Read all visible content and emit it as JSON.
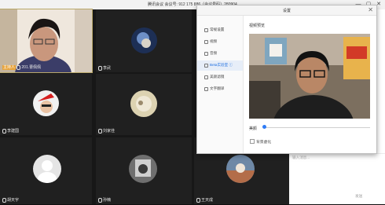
{
  "window": {
    "title": "腾讯会议 会议号: 912 175 886（会议号码）280904",
    "minimize_label": "—",
    "maximize_label": "▢",
    "close_label": "✕"
  },
  "participants": [
    {
      "name": "201.曹佩佩",
      "host_tag": "主持人",
      "video": true
    },
    {
      "name": "李武",
      "video": false
    },
    {
      "name": "",
      "video": false
    },
    {
      "name": "李建国",
      "video": false
    },
    {
      "name": "刘家佳",
      "video": false
    },
    {
      "name": "",
      "video": false
    },
    {
      "name": "胡天宇",
      "video": false
    },
    {
      "name": "孙楠",
      "video": false
    },
    {
      "name": "王天成",
      "video": false
    }
  ],
  "settings": {
    "title": "设置",
    "close_label": "✕",
    "nav": [
      {
        "label": "常规设置"
      },
      {
        "label": "视频"
      },
      {
        "label": "音频"
      },
      {
        "label": "Beta实验室 ⓘ"
      },
      {
        "label": "美颜滤镜"
      },
      {
        "label": "文字翻译"
      }
    ],
    "active_nav": 3,
    "section_label": "视频预览",
    "slider_label": "美颜",
    "slider_value": 0.02,
    "checkbox_label": "背景虚化",
    "checkbox_checked": false
  },
  "chat": {
    "placeholder": "输入消息...",
    "send_label": "发送"
  },
  "colors": {
    "accent": "#2f7cf6",
    "host_tag": "#e8a33a"
  }
}
